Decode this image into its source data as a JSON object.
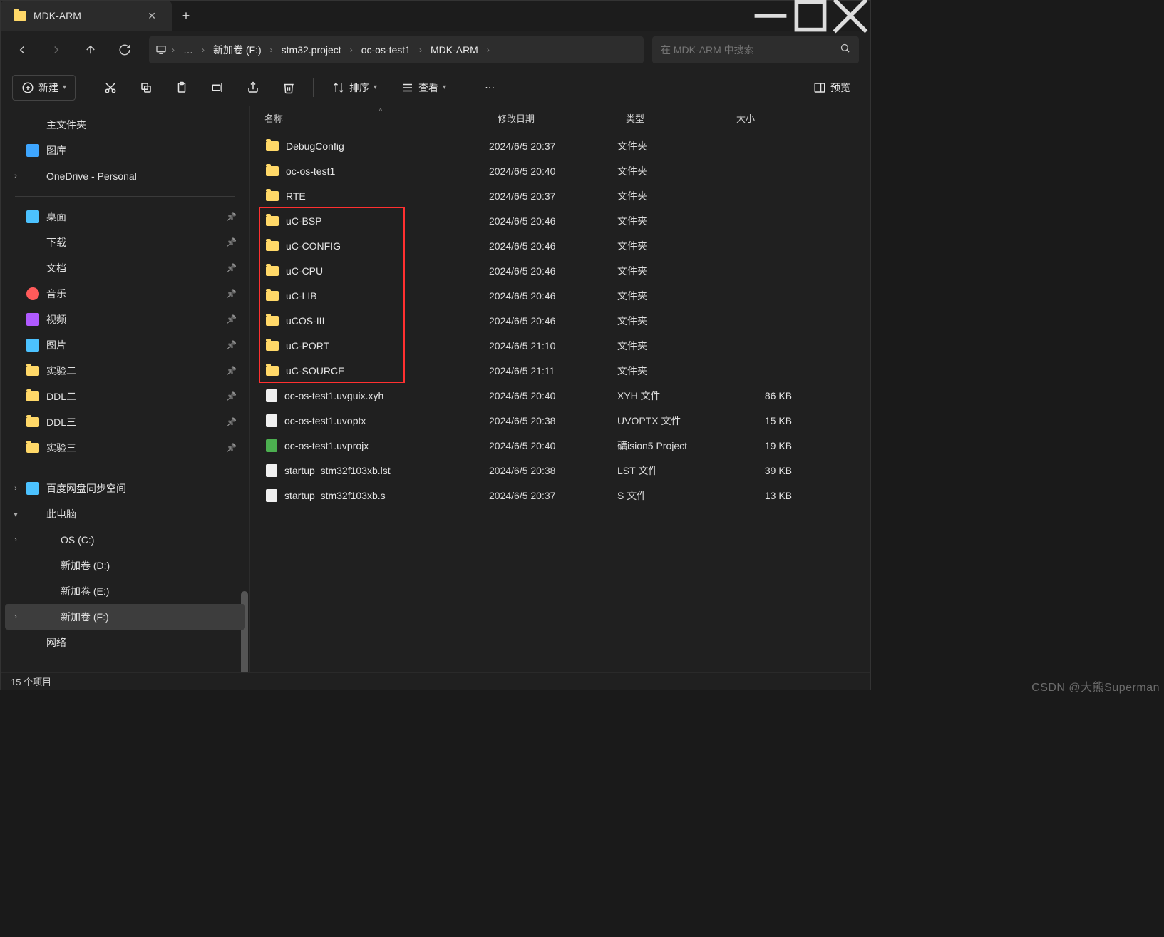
{
  "window": {
    "tab_title": "MDK-ARM",
    "new_tab": "+"
  },
  "nav": {
    "crumbs": [
      "新加卷 (F:)",
      "stm32.project",
      "oc-os-test1",
      "MDK-ARM"
    ],
    "more": "…"
  },
  "search": {
    "placeholder": "在 MDK-ARM 中搜索"
  },
  "toolbar": {
    "new_label": "新建",
    "sort_label": "排序",
    "view_label": "查看",
    "preview_label": "预览"
  },
  "sidebar": {
    "top": [
      {
        "label": "主文件夹",
        "icon": "home"
      },
      {
        "label": "图库",
        "icon": "gallery"
      },
      {
        "label": "OneDrive - Personal",
        "icon": "cloud",
        "expandable": true
      }
    ],
    "pinned": [
      {
        "label": "桌面",
        "icon": "desktop"
      },
      {
        "label": "下载",
        "icon": "download"
      },
      {
        "label": "文档",
        "icon": "doc"
      },
      {
        "label": "音乐",
        "icon": "music"
      },
      {
        "label": "视频",
        "icon": "video"
      },
      {
        "label": "图片",
        "icon": "pic"
      },
      {
        "label": "实验二",
        "icon": "folder"
      },
      {
        "label": "DDL二",
        "icon": "folder"
      },
      {
        "label": "DDL三",
        "icon": "folder"
      },
      {
        "label": "实验三",
        "icon": "folder"
      }
    ],
    "lower": [
      {
        "label": "百度网盘同步空间",
        "icon": "sync",
        "expandable": true
      },
      {
        "label": "此电脑",
        "icon": "pc",
        "expanded": true
      },
      {
        "label": "OS (C:)",
        "icon": "drive",
        "sub": true,
        "expandable": true
      },
      {
        "label": "新加卷 (D:)",
        "icon": "drive",
        "sub": true
      },
      {
        "label": "新加卷 (E:)",
        "icon": "drive",
        "sub": true
      },
      {
        "label": "新加卷 (F:)",
        "icon": "drive",
        "sub": true,
        "selected": true,
        "expandable": true
      },
      {
        "label": "网络",
        "icon": "net"
      }
    ]
  },
  "columns": {
    "name": "名称",
    "date": "修改日期",
    "type": "类型",
    "size": "大小"
  },
  "files": [
    {
      "name": "DebugConfig",
      "date": "2024/6/5 20:37",
      "type": "文件夹",
      "size": "",
      "folder": true
    },
    {
      "name": "oc-os-test1",
      "date": "2024/6/5 20:40",
      "type": "文件夹",
      "size": "",
      "folder": true
    },
    {
      "name": "RTE",
      "date": "2024/6/5 20:37",
      "type": "文件夹",
      "size": "",
      "folder": true
    },
    {
      "name": "uC-BSP",
      "date": "2024/6/5 20:46",
      "type": "文件夹",
      "size": "",
      "folder": true,
      "hl": true
    },
    {
      "name": "uC-CONFIG",
      "date": "2024/6/5 20:46",
      "type": "文件夹",
      "size": "",
      "folder": true,
      "hl": true
    },
    {
      "name": "uC-CPU",
      "date": "2024/6/5 20:46",
      "type": "文件夹",
      "size": "",
      "folder": true,
      "hl": true
    },
    {
      "name": "uC-LIB",
      "date": "2024/6/5 20:46",
      "type": "文件夹",
      "size": "",
      "folder": true,
      "hl": true
    },
    {
      "name": "uCOS-III",
      "date": "2024/6/5 20:46",
      "type": "文件夹",
      "size": "",
      "folder": true,
      "hl": true
    },
    {
      "name": "uC-PORT",
      "date": "2024/6/5 21:10",
      "type": "文件夹",
      "size": "",
      "folder": true,
      "hl": true
    },
    {
      "name": "uC-SOURCE",
      "date": "2024/6/5 21:11",
      "type": "文件夹",
      "size": "",
      "folder": true,
      "hl": true
    },
    {
      "name": "oc-os-test1.uvguix.xyh",
      "date": "2024/6/5 20:40",
      "type": "XYH 文件",
      "size": "86 KB",
      "folder": false
    },
    {
      "name": "oc-os-test1.uvoptx",
      "date": "2024/6/5 20:38",
      "type": "UVOPTX 文件",
      "size": "15 KB",
      "folder": false
    },
    {
      "name": "oc-os-test1.uvprojx",
      "date": "2024/6/5 20:40",
      "type": "礦ision5 Project",
      "size": "19 KB",
      "folder": false,
      "proj": true
    },
    {
      "name": "startup_stm32f103xb.lst",
      "date": "2024/6/5 20:38",
      "type": "LST 文件",
      "size": "39 KB",
      "folder": false
    },
    {
      "name": "startup_stm32f103xb.s",
      "date": "2024/6/5 20:37",
      "type": "S 文件",
      "size": "13 KB",
      "folder": false
    }
  ],
  "status": {
    "count_label": "15 个项目"
  },
  "watermark": "CSDN @大熊Superman"
}
